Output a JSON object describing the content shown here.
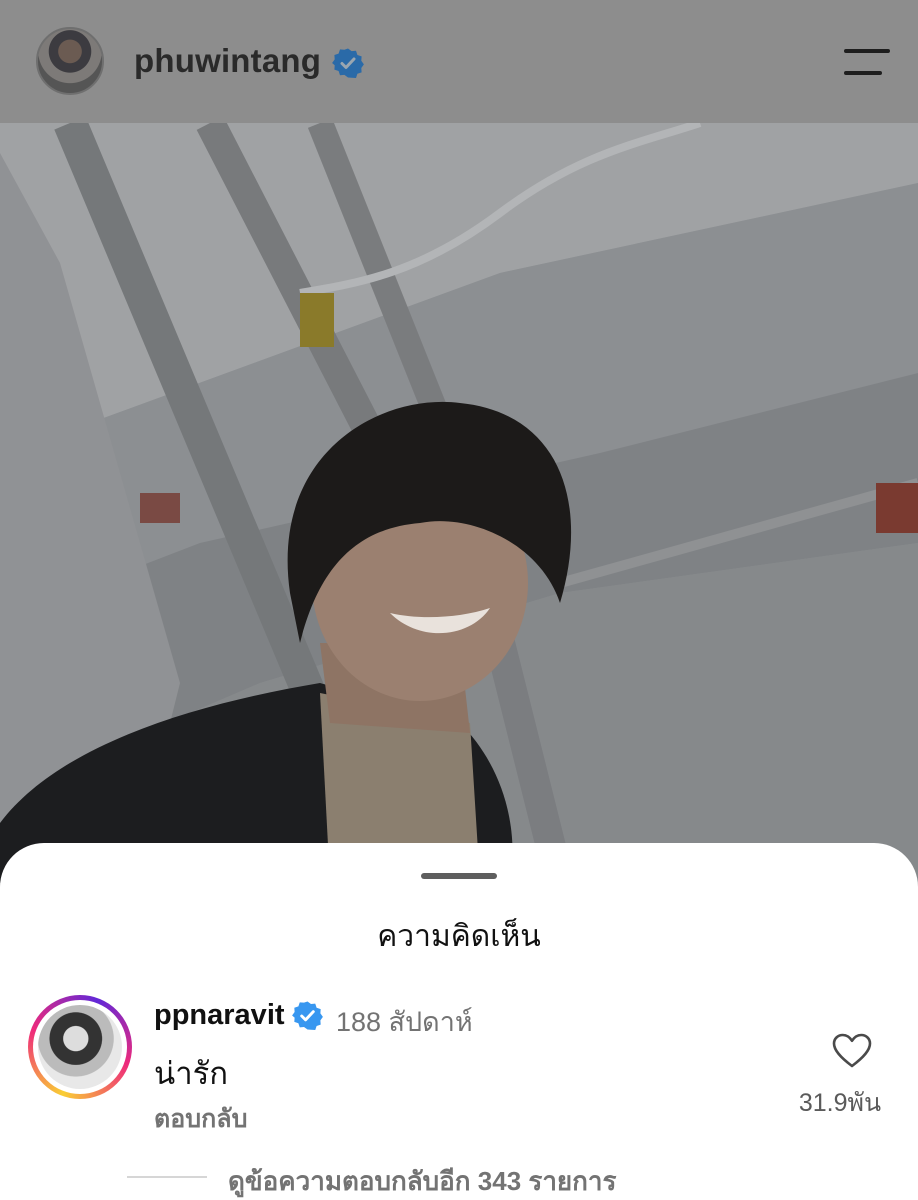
{
  "header": {
    "username": "phuwintang",
    "avatar_icon": "profile-avatar",
    "verified_icon": "verified-badge-icon",
    "menu_icon": "hamburger-menu-icon"
  },
  "sheet": {
    "title": "ความคิดเห็น"
  },
  "comment": {
    "username": "ppnaravit",
    "time": "188 สัปดาห์",
    "text": "น่ารัก",
    "reply_label": "ตอบกลับ",
    "like_count": "31.9พัน",
    "view_replies": "ดูข้อความตอบกลับอีก 343 รายการ"
  },
  "colors": {
    "verified": "#3897f0",
    "overlay": "#8a8a8a",
    "sheet": "#ffffff",
    "muted_text": "#737373"
  }
}
